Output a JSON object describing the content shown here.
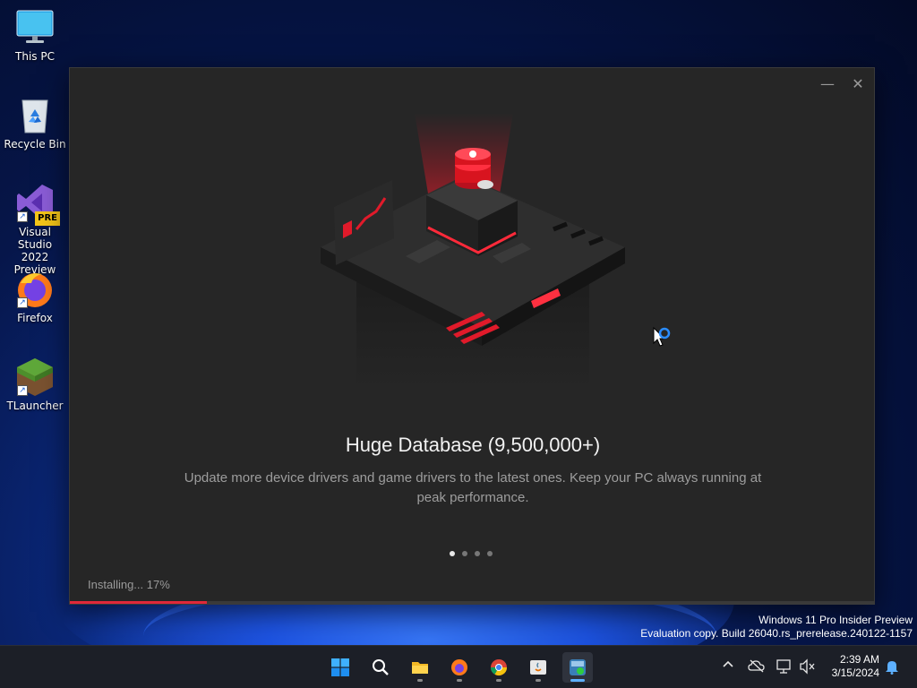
{
  "desktop": {
    "icons": [
      {
        "label": "This PC"
      },
      {
        "label": "Recycle Bin"
      },
      {
        "label": "Visual Studio\n2022 Preview",
        "badge": "PRE"
      },
      {
        "label": "Firefox"
      },
      {
        "label": "TLauncher"
      }
    ]
  },
  "installer": {
    "minimize_glyph": "—",
    "close_glyph": "✕",
    "slide_title": "Huge Database (9,500,000+)",
    "slide_description": "Update more device drivers and game drivers to the latest ones. Keep your PC always running at peak performance.",
    "slides_total": 4,
    "slide_active": 1,
    "status_text": "Installing... 17%",
    "progress_fraction": 0.17,
    "accent_color": "#e0283a"
  },
  "watermark": {
    "line1": "Windows 11 Pro Insider Preview",
    "line2": "Evaluation copy. Build 26040.rs_prerelease.240122-1157"
  },
  "taskbar": {
    "apps": [
      "windows-start-icon",
      "search-icon",
      "file-explorer-icon",
      "firefox-icon",
      "chrome-icon",
      "java-installer-icon",
      "driver-booster-icon"
    ],
    "tray": [
      "chevron-up-icon",
      "onedrive-offline-icon",
      "network-icon",
      "volume-muted-icon",
      "notification-bell-icon"
    ],
    "time": "2:39 AM",
    "date": "3/15/2024"
  }
}
